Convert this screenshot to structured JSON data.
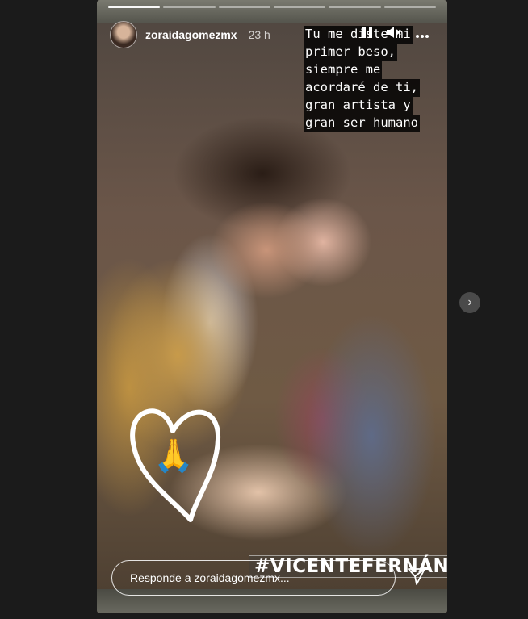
{
  "story": {
    "username": "zoraidagomezmx",
    "time": "23 h",
    "progress_segments": 6,
    "progress_completed": 1
  },
  "icons": {
    "pause": "pause-icon",
    "mute": "mute-icon",
    "more": "more-options-icon",
    "send": "send-icon",
    "next": "chevron-right-icon",
    "emoji": "🙏"
  },
  "caption": {
    "lines": [
      "Tu me diste mi",
      "primer beso,",
      "siempre me",
      "acordaré de ti,",
      "gran artista y",
      "gran ser humano"
    ]
  },
  "hashtag": "#VICENTEFERNÁNDEZ",
  "reply": {
    "placeholder": "Responde a zoraidagomezmx..."
  },
  "navigation": {
    "next_label": "›"
  },
  "colors": {
    "page_background": "#1b1b1b",
    "caption_background": "#000000",
    "text": "#ffffff"
  }
}
